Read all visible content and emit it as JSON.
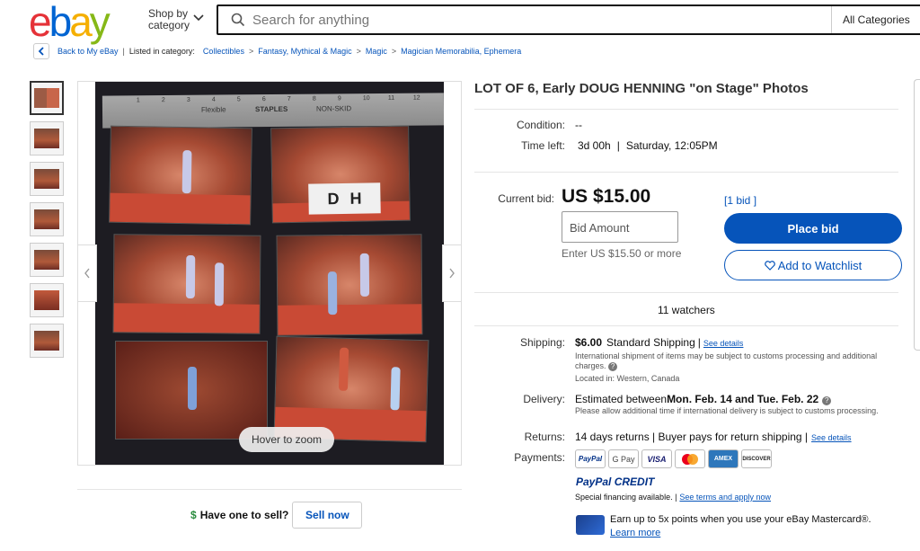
{
  "header": {
    "logo_letters": [
      "e",
      "b",
      "a",
      "y"
    ],
    "shop_by_line1": "Shop by",
    "shop_by_line2": "category",
    "search_placeholder": "Search for anything",
    "category_select": "All Categories"
  },
  "breadcrumb": {
    "back": "Back to My eBay",
    "listed_in": "Listed in category:",
    "items": [
      "Collectibles",
      "Fantasy, Mythical & Magic",
      "Magic",
      "Magician Memorabilia, Ephemera"
    ],
    "separator": ">"
  },
  "gallery": {
    "thumb_count": 7,
    "hover_to_zoom": "Hover to zoom",
    "ruler_labels": [
      "Flexible",
      "STAPLES",
      "NON-SKID"
    ],
    "ruler_numbers": [
      "1",
      "2",
      "3",
      "4",
      "5",
      "6",
      "7",
      "8",
      "9",
      "10",
      "11",
      "12"
    ],
    "sign_letters": [
      "D",
      "H"
    ]
  },
  "sell": {
    "prompt": "Have one to sell?",
    "button": "Sell now"
  },
  "listing": {
    "title": "LOT OF 6, Early DOUG HENNING \"on Stage\" Photos",
    "condition_label": "Condition:",
    "condition_value": "--",
    "time_left_label": "Time left:",
    "time_left_value": "3d 00h",
    "time_left_end": "Saturday, 12:05PM",
    "current_bid_label": "Current bid:",
    "current_bid": "US $15.00",
    "bids_link": "[1 bid ]",
    "bid_placeholder": "Bid Amount",
    "bid_hint": "Enter US $15.50 or more",
    "place_bid": "Place bid",
    "add_watchlist": "Add to Watchlist",
    "watchers": "11 watchers"
  },
  "shipping": {
    "label": "Shipping:",
    "price": "$6.00",
    "method": "Standard Shipping",
    "see_details": "See details",
    "intl_note": "International shipment of items may be subject to customs processing and additional charges.",
    "location": "Located in:  Western, Canada"
  },
  "delivery": {
    "label": "Delivery:",
    "text_prefix": "Estimated between ",
    "dates": "Mon. Feb. 14 and Tue. Feb. 22",
    "note": "Please allow additional time if international delivery is subject to customs processing."
  },
  "returns": {
    "label": "Returns:",
    "text": "14 days returns | Buyer pays for return shipping |",
    "see_details": "See details"
  },
  "payments": {
    "label": "Payments:",
    "methods": [
      "PayPal",
      "G Pay",
      "VISA",
      "MC",
      "AMEX",
      "DISCOVER"
    ],
    "paypal_credit": "PayPal CREDIT",
    "financing": "Special financing available. |",
    "financing_link": "See terms and apply now",
    "mastercard_promo": "Earn up to 5x points when you use your eBay Mastercard®.",
    "learn_more": "Learn more"
  },
  "colors": {
    "ebay_red": "#e53238",
    "ebay_blue": "#0064d2",
    "ebay_yellow": "#f5af02",
    "ebay_green": "#86b817",
    "link_blue": "#0654ba"
  }
}
